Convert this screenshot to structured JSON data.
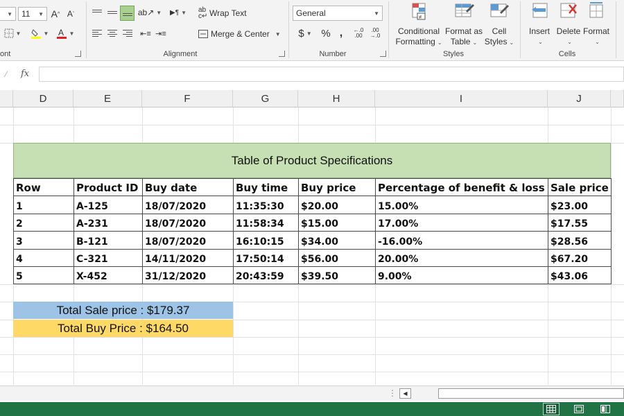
{
  "ribbon": {
    "font": {
      "size": "11",
      "label": "ont"
    },
    "alignment": {
      "wrap_text": "Wrap Text",
      "merge_center": "Merge & Center",
      "label": "Alignment"
    },
    "number": {
      "format": "General",
      "dollar": "$",
      "percent": "%",
      "comma": ",",
      "inc_decimal": "←.0 .00",
      "dec_decimal": ".00 →.0",
      "label": "Number"
    },
    "styles": {
      "conditional_line1": "Conditional",
      "conditional_line2": "Formatting",
      "format_table_line1": "Format as",
      "format_table_line2": "Table",
      "cell_styles_line1": "Cell",
      "cell_styles_line2": "Styles",
      "label": "Styles"
    },
    "cells": {
      "insert": "Insert",
      "delete": "Delete",
      "format": "Format",
      "label": "Cells"
    }
  },
  "formula_bar": {
    "fx": "fx",
    "value": ""
  },
  "columns": [
    "D",
    "E",
    "F",
    "G",
    "H",
    "I",
    "J"
  ],
  "sheet": {
    "title": "Table of Product Specifications",
    "headers": [
      "Row",
      "Product ID",
      "Buy date",
      "Buy time",
      "Buy price",
      "Percentage of benefit & loss",
      "Sale price"
    ],
    "rows": [
      [
        "1",
        "A-125",
        "18/07/2020",
        "11:35:30",
        "$20.00",
        "15.00%",
        "$23.00"
      ],
      [
        "2",
        "A-231",
        "18/07/2020",
        "11:58:34",
        "$15.00",
        "17.00%",
        "$17.55"
      ],
      [
        "3",
        "B-121",
        "18/07/2020",
        "16:10:15",
        "$34.00",
        "-16.00%",
        "$28.56"
      ],
      [
        "4",
        "C-321",
        "14/11/2020",
        "17:50:14",
        "$56.00",
        "20.00%",
        "$67.20"
      ],
      [
        "5",
        "X-452",
        "31/12/2020",
        "20:43:59",
        "$39.50",
        "9.00%",
        "$43.06"
      ]
    ],
    "total_sale": "Total Sale price : $179.37",
    "total_buy": "Total Buy Price : $164.50"
  },
  "colors": {
    "title_fill": "#c6e0b4",
    "total_sale_fill": "#9dc3e6",
    "total_buy_fill": "#ffd966",
    "status_bar": "#217346"
  }
}
